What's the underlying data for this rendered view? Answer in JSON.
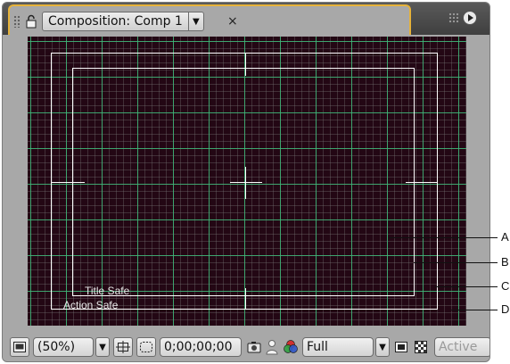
{
  "panel": {
    "tab_title": "Composition: Comp 1",
    "close_glyph": "×",
    "dropdown_glyph": "▼"
  },
  "viewer": {
    "title_safe_label": "Title Safe",
    "action_safe_label": "Action Safe",
    "background_color": "#230714",
    "grid_color": "#3cb978"
  },
  "callouts": [
    "A",
    "B",
    "C",
    "D"
  ],
  "toolbar": {
    "magnification": "(50%)",
    "timecode": "0;00;00;00",
    "resolution": "Full",
    "camera_view": "Active",
    "dropdown_glyph": "▼"
  },
  "icons": {
    "lock": "lock-icon",
    "panel_menu": "panel-menu-icon",
    "preview": "always-preview-icon",
    "grid": "grid-guides-icon",
    "mask": "mask-visibility-icon",
    "snapshot": "snapshot-icon",
    "show_snapshot": "show-snapshot-icon",
    "channels": "rgb-channels-icon",
    "roi": "region-of-interest-icon",
    "transparency": "transparency-grid-icon"
  }
}
